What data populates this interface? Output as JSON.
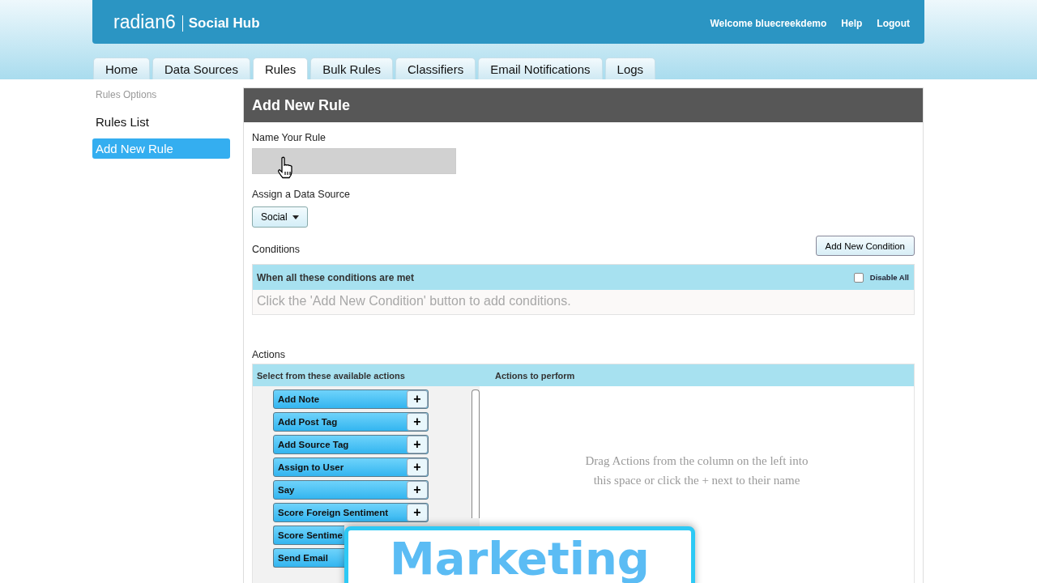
{
  "header": {
    "logo": "radian6",
    "product": "Social Hub",
    "links": [
      "Welcome bluecreekdemo",
      "Help",
      "Logout"
    ]
  },
  "tabs": [
    {
      "label": "Home",
      "selected": false
    },
    {
      "label": "Data Sources",
      "selected": false
    },
    {
      "label": "Rules",
      "selected": true
    },
    {
      "label": "Bulk Rules",
      "selected": false
    },
    {
      "label": "Classifiers",
      "selected": false
    },
    {
      "label": "Email Notifications",
      "selected": false
    },
    {
      "label": "Logs",
      "selected": false
    }
  ],
  "sidebar": {
    "title": "Rules Options",
    "items": [
      {
        "label": "Rules List",
        "selected": false
      },
      {
        "label": "Add New Rule",
        "selected": true
      }
    ]
  },
  "panel": {
    "title": "Add New Rule",
    "name_label": "Name Your Rule",
    "source_label": "Assign a Data Source",
    "source_value": "Social",
    "conditions_label": "Conditions",
    "add_condition": "Add New Condition",
    "conditions_header": "When all these conditions are met",
    "disable_all": {
      "label": "Disable All",
      "checked": false
    },
    "conditions_empty": "Click the 'Add New Condition' button to add conditions.",
    "actions_label": "Actions",
    "available_header": "Select from these available actions",
    "perform_header": "Actions to perform",
    "available_actions": [
      {
        "label": "Add Note",
        "kind": "full"
      },
      {
        "label": "Add Post Tag",
        "kind": "full"
      },
      {
        "label": "Add Source Tag",
        "kind": "full"
      },
      {
        "label": "Assign to User",
        "kind": "full"
      },
      {
        "label": "Say",
        "kind": "full"
      },
      {
        "label": "Score Foreign Sentiment",
        "kind": "full"
      },
      {
        "label": "Score Sentime",
        "kind": "partial"
      },
      {
        "label": "Send Email",
        "kind": "partial"
      }
    ],
    "plus": "+",
    "perform_empty": "Drag Actions from the column on the left into this space or click the + next to their name"
  },
  "caption": "Marketing"
}
